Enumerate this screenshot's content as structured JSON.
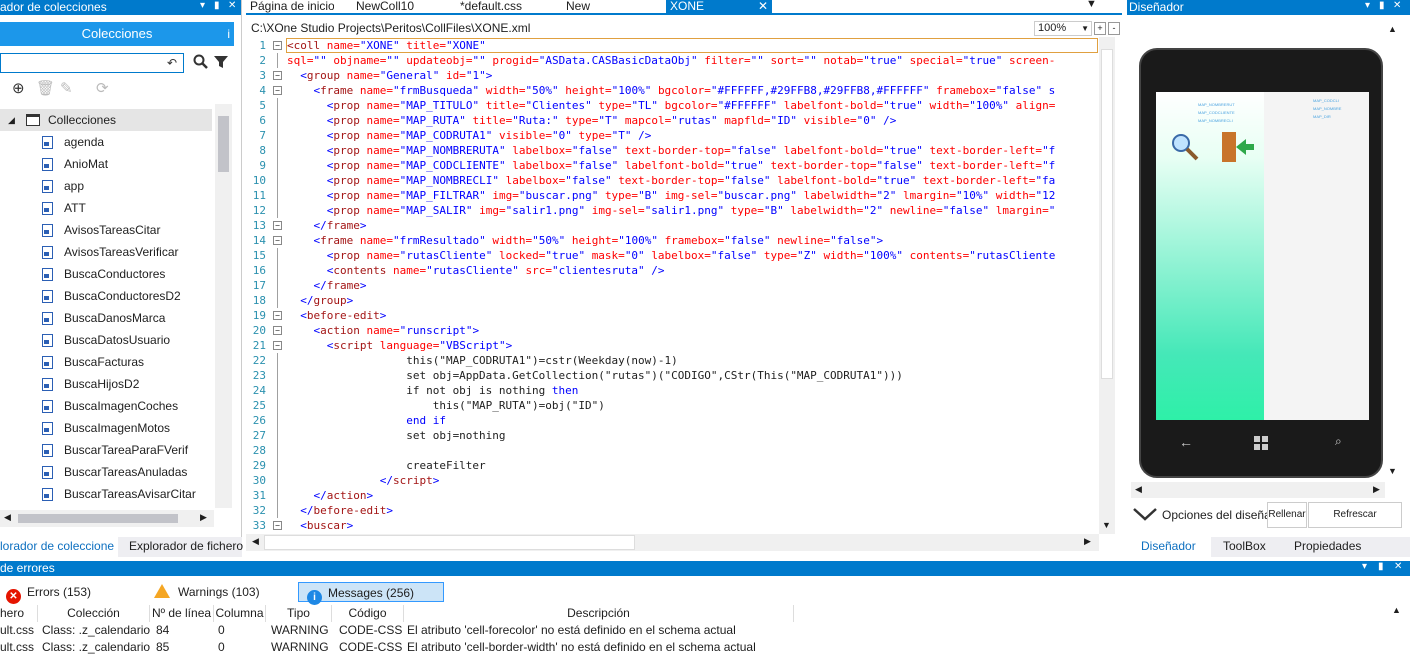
{
  "left_panel": {
    "title": "ador de colecciones",
    "tab_label": "Colecciones",
    "info_glyph": "i",
    "search_placeholder": "",
    "root_label": "Collecciones",
    "items": [
      "agenda",
      "AnioMat",
      "app",
      "ATT",
      "AvisosTareasCitar",
      "AvisosTareasVerificar",
      "BuscaConductores",
      "BuscaConductoresD2",
      "BuscaDanosMarca",
      "BuscaDatosUsuario",
      "BuscaFacturas",
      "BuscaHijosD2",
      "BuscaImagenCoches",
      "BuscaImagenMotos",
      "BuscarTareaParaFVerif",
      "BuscarTareasAnuladas",
      "BuscarTareasAvisarCitar"
    ],
    "bottom_tabs": [
      "lorador de coleccione",
      "Explorador de fichero"
    ]
  },
  "editor": {
    "tabs": [
      "Página de inicio",
      "NewColl10",
      "*default.css",
      "New",
      "XONE"
    ],
    "path": "C:\\XOne Studio Projects\\Peritos\\CollFiles\\XONE.xml",
    "zoom": "100%",
    "zoom_plus": "+",
    "zoom_minus": "-",
    "line_numbers": [
      "1",
      "2",
      "3",
      "4",
      "5",
      "6",
      "7",
      "8",
      "9",
      "10",
      "11",
      "12",
      "13",
      "14",
      "15",
      "16",
      "17",
      "18",
      "19",
      "20",
      "21",
      "22",
      "23",
      "24",
      "25",
      "26",
      "27",
      "28",
      "29",
      "30",
      "31",
      "32",
      "33"
    ]
  },
  "code_lines": [
    [
      [
        "t",
        "<coll "
      ],
      [
        "a",
        "name="
      ],
      [
        "v",
        "\"XONE\" "
      ],
      [
        "a",
        "title="
      ],
      [
        "v",
        "\"XONE\""
      ]
    ],
    [
      [
        "a",
        "sql="
      ],
      [
        "v",
        "\"\" "
      ],
      [
        "a",
        "objname="
      ],
      [
        "v",
        "\"\" "
      ],
      [
        "a",
        "updateobj="
      ],
      [
        "v",
        "\"\" "
      ],
      [
        "a",
        "progid="
      ],
      [
        "v",
        "\"ASData.CASBasicDataObj\" "
      ],
      [
        "a",
        "filter="
      ],
      [
        "v",
        "\"\" "
      ],
      [
        "a",
        "sort="
      ],
      [
        "v",
        "\"\" "
      ],
      [
        "a",
        "notab="
      ],
      [
        "v",
        "\"true\" "
      ],
      [
        "a",
        "special="
      ],
      [
        "v",
        "\"true\" "
      ],
      [
        "a",
        "screen-"
      ]
    ],
    [
      [
        "s",
        "  "
      ],
      [
        "p",
        "<"
      ],
      [
        "t",
        "group "
      ],
      [
        "a",
        "name="
      ],
      [
        "v",
        "\"General\" "
      ],
      [
        "a",
        "id="
      ],
      [
        "v",
        "\"1\""
      ],
      [
        "p",
        ">"
      ]
    ],
    [
      [
        "s",
        "    "
      ],
      [
        "p",
        "<"
      ],
      [
        "t",
        "frame "
      ],
      [
        "a",
        "name="
      ],
      [
        "v",
        "\"frmBusqueda\" "
      ],
      [
        "a",
        "width="
      ],
      [
        "v",
        "\"50%\" "
      ],
      [
        "a",
        "height="
      ],
      [
        "v",
        "\"100%\" "
      ],
      [
        "a",
        "bgcolor="
      ],
      [
        "v",
        "\"#FFFFFF,#29FFB8,#29FFB8,#FFFFFF\" "
      ],
      [
        "a",
        "framebox="
      ],
      [
        "v",
        "\"false\" s"
      ]
    ],
    [
      [
        "s",
        "      "
      ],
      [
        "p",
        "<"
      ],
      [
        "t",
        "prop "
      ],
      [
        "a",
        "name="
      ],
      [
        "v",
        "\"MAP_TITULO\" "
      ],
      [
        "a",
        "title="
      ],
      [
        "v",
        "\"Clientes\" "
      ],
      [
        "a",
        "type="
      ],
      [
        "v",
        "\"TL\" "
      ],
      [
        "a",
        "bgcolor="
      ],
      [
        "v",
        "\"#FFFFFF\" "
      ],
      [
        "a",
        "labelfont-bold="
      ],
      [
        "v",
        "\"true\" "
      ],
      [
        "a",
        "width="
      ],
      [
        "v",
        "\"100%\" "
      ],
      [
        "a",
        "align="
      ]
    ],
    [
      [
        "s",
        "      "
      ],
      [
        "p",
        "<"
      ],
      [
        "t",
        "prop "
      ],
      [
        "a",
        "name="
      ],
      [
        "v",
        "\"MAP_RUTA\" "
      ],
      [
        "a",
        "title="
      ],
      [
        "v",
        "\"Ruta:\" "
      ],
      [
        "a",
        "type="
      ],
      [
        "v",
        "\"T\" "
      ],
      [
        "a",
        "mapcol="
      ],
      [
        "v",
        "\"rutas\" "
      ],
      [
        "a",
        "mapfld="
      ],
      [
        "v",
        "\"ID\" "
      ],
      [
        "a",
        "visible="
      ],
      [
        "v",
        "\"0\" "
      ],
      [
        "p",
        "/>"
      ]
    ],
    [
      [
        "s",
        "      "
      ],
      [
        "p",
        "<"
      ],
      [
        "t",
        "prop "
      ],
      [
        "a",
        "name="
      ],
      [
        "v",
        "\"MAP_CODRUTA1\" "
      ],
      [
        "a",
        "visible="
      ],
      [
        "v",
        "\"0\" "
      ],
      [
        "a",
        "type="
      ],
      [
        "v",
        "\"T\" "
      ],
      [
        "p",
        "/>"
      ]
    ],
    [
      [
        "s",
        "      "
      ],
      [
        "p",
        "<"
      ],
      [
        "t",
        "prop "
      ],
      [
        "a",
        "name="
      ],
      [
        "v",
        "\"MAP_NOMBRERUTA\" "
      ],
      [
        "a",
        "labelbox="
      ],
      [
        "v",
        "\"false\" "
      ],
      [
        "a",
        "text-border-top="
      ],
      [
        "v",
        "\"false\" "
      ],
      [
        "a",
        "labelfont-bold="
      ],
      [
        "v",
        "\"true\" "
      ],
      [
        "a",
        "text-border-left="
      ],
      [
        "v",
        "\"f"
      ]
    ],
    [
      [
        "s",
        "      "
      ],
      [
        "p",
        "<"
      ],
      [
        "t",
        "prop "
      ],
      [
        "a",
        "name="
      ],
      [
        "v",
        "\"MAP_CODCLIENTE\" "
      ],
      [
        "a",
        "labelbox="
      ],
      [
        "v",
        "\"false\" "
      ],
      [
        "a",
        "labelfont-bold="
      ],
      [
        "v",
        "\"true\" "
      ],
      [
        "a",
        "text-border-top="
      ],
      [
        "v",
        "\"false\" "
      ],
      [
        "a",
        "text-border-left="
      ],
      [
        "v",
        "\"f"
      ]
    ],
    [
      [
        "s",
        "      "
      ],
      [
        "p",
        "<"
      ],
      [
        "t",
        "prop "
      ],
      [
        "a",
        "name="
      ],
      [
        "v",
        "\"MAP_NOMBRECLI\" "
      ],
      [
        "a",
        "labelbox="
      ],
      [
        "v",
        "\"false\" "
      ],
      [
        "a",
        "text-border-top="
      ],
      [
        "v",
        "\"false\" "
      ],
      [
        "a",
        "labelfont-bold="
      ],
      [
        "v",
        "\"true\" "
      ],
      [
        "a",
        "text-border-left="
      ],
      [
        "v",
        "\"fa"
      ]
    ],
    [
      [
        "s",
        "      "
      ],
      [
        "p",
        "<"
      ],
      [
        "t",
        "prop "
      ],
      [
        "a",
        "name="
      ],
      [
        "v",
        "\"MAP_FILTRAR\" "
      ],
      [
        "a",
        "img="
      ],
      [
        "v",
        "\"buscar.png\" "
      ],
      [
        "a",
        "type="
      ],
      [
        "v",
        "\"B\" "
      ],
      [
        "a",
        "img-sel="
      ],
      [
        "v",
        "\"buscar.png\" "
      ],
      [
        "a",
        "labelwidth="
      ],
      [
        "v",
        "\"2\" "
      ],
      [
        "a",
        "lmargin="
      ],
      [
        "v",
        "\"10%\" "
      ],
      [
        "a",
        "width="
      ],
      [
        "v",
        "\"12"
      ]
    ],
    [
      [
        "s",
        "      "
      ],
      [
        "p",
        "<"
      ],
      [
        "t",
        "prop "
      ],
      [
        "a",
        "name="
      ],
      [
        "v",
        "\"MAP_SALIR\" "
      ],
      [
        "a",
        "img="
      ],
      [
        "v",
        "\"salir1.png\" "
      ],
      [
        "a",
        "img-sel="
      ],
      [
        "v",
        "\"salir1.png\" "
      ],
      [
        "a",
        "type="
      ],
      [
        "v",
        "\"B\" "
      ],
      [
        "a",
        "labelwidth="
      ],
      [
        "v",
        "\"2\" "
      ],
      [
        "a",
        "newline="
      ],
      [
        "v",
        "\"false\" "
      ],
      [
        "a",
        "lmargin="
      ],
      [
        "v",
        "\""
      ]
    ],
    [
      [
        "s",
        "    "
      ],
      [
        "p",
        "</"
      ],
      [
        "t",
        "frame"
      ],
      [
        "p",
        ">"
      ]
    ],
    [
      [
        "s",
        "    "
      ],
      [
        "p",
        "<"
      ],
      [
        "t",
        "frame "
      ],
      [
        "a",
        "name="
      ],
      [
        "v",
        "\"frmResultado\" "
      ],
      [
        "a",
        "width="
      ],
      [
        "v",
        "\"50%\" "
      ],
      [
        "a",
        "height="
      ],
      [
        "v",
        "\"100%\" "
      ],
      [
        "a",
        "framebox="
      ],
      [
        "v",
        "\"false\" "
      ],
      [
        "a",
        "newline="
      ],
      [
        "v",
        "\"false\""
      ],
      [
        "p",
        ">"
      ]
    ],
    [
      [
        "s",
        "      "
      ],
      [
        "p",
        "<"
      ],
      [
        "t",
        "prop "
      ],
      [
        "a",
        "name="
      ],
      [
        "v",
        "\"rutasCliente\" "
      ],
      [
        "a",
        "locked="
      ],
      [
        "v",
        "\"true\" "
      ],
      [
        "a",
        "mask="
      ],
      [
        "v",
        "\"0\" "
      ],
      [
        "a",
        "labelbox="
      ],
      [
        "v",
        "\"false\" "
      ],
      [
        "a",
        "type="
      ],
      [
        "v",
        "\"Z\" "
      ],
      [
        "a",
        "width="
      ],
      [
        "v",
        "\"100%\" "
      ],
      [
        "a",
        "contents="
      ],
      [
        "v",
        "\"rutasCliente"
      ]
    ],
    [
      [
        "s",
        "      "
      ],
      [
        "p",
        "<"
      ],
      [
        "t",
        "contents "
      ],
      [
        "a",
        "name="
      ],
      [
        "v",
        "\"rutasCliente\" "
      ],
      [
        "a",
        "src="
      ],
      [
        "v",
        "\"clientesruta\" "
      ],
      [
        "p",
        "/>"
      ]
    ],
    [
      [
        "s",
        "    "
      ],
      [
        "p",
        "</"
      ],
      [
        "t",
        "frame"
      ],
      [
        "p",
        ">"
      ]
    ],
    [
      [
        "s",
        "  "
      ],
      [
        "p",
        "</"
      ],
      [
        "t",
        "group"
      ],
      [
        "p",
        ">"
      ]
    ],
    [
      [
        "s",
        "  "
      ],
      [
        "p",
        "<"
      ],
      [
        "t",
        "before-edit"
      ],
      [
        "p",
        ">"
      ]
    ],
    [
      [
        "s",
        "    "
      ],
      [
        "p",
        "<"
      ],
      [
        "t",
        "action "
      ],
      [
        "a",
        "name="
      ],
      [
        "v",
        "\"runscript\""
      ],
      [
        "p",
        ">"
      ]
    ],
    [
      [
        "s",
        "      "
      ],
      [
        "p",
        "<"
      ],
      [
        "t",
        "script "
      ],
      [
        "a",
        "language="
      ],
      [
        "v",
        "\"VBScript\""
      ],
      [
        "p",
        ">"
      ]
    ],
    [
      [
        "s",
        "                  this(\"MAP_CODRUTA1\")=cstr(Weekday(now)-1)"
      ]
    ],
    [
      [
        "s",
        "                  set obj=AppData.GetCollection(\"rutas\")(\"CODIGO\",CStr(This(\"MAP_CODRUTA1\")))"
      ]
    ],
    [
      [
        "s",
        "                  if not obj is nothing "
      ],
      [
        "v",
        "then"
      ]
    ],
    [
      [
        "s",
        "                      this(\"MAP_RUTA\")=obj(\"ID\")"
      ]
    ],
    [
      [
        "s",
        "                  "
      ],
      [
        "v",
        "end if"
      ]
    ],
    [
      [
        "s",
        "                  set obj=nothing"
      ]
    ],
    [
      [
        "s",
        ""
      ]
    ],
    [
      [
        "s",
        "                  createFilter"
      ]
    ],
    [
      [
        "s",
        "              "
      ],
      [
        "p",
        "</"
      ],
      [
        "t",
        "script"
      ],
      [
        "p",
        ">"
      ]
    ],
    [
      [
        "s",
        "    "
      ],
      [
        "p",
        "</"
      ],
      [
        "t",
        "action"
      ],
      [
        "p",
        ">"
      ]
    ],
    [
      [
        "s",
        "  "
      ],
      [
        "p",
        "</"
      ],
      [
        "t",
        "before-edit"
      ],
      [
        "p",
        ">"
      ]
    ],
    [
      [
        "s",
        "  "
      ],
      [
        "p",
        "<"
      ],
      [
        "t",
        "buscar"
      ],
      [
        "p",
        ">"
      ]
    ]
  ],
  "designer": {
    "title": "Diseñador",
    "screen_labels_left": [
      "MAP_NOMBRERUT",
      "MAP_CODCLIENTE",
      "MAP_NOMBRECLI"
    ],
    "screen_labels_right": [
      "MAP_CODCLI",
      "MAP_NOMBRE",
      "MAP_DIR"
    ],
    "options_label": "Opciones del diseña",
    "rellenar_label": "Rellenar",
    "refrescar_label": "Refrescar",
    "tabs": [
      "Diseñador",
      "ToolBox",
      "Propiedades"
    ]
  },
  "errors_panel": {
    "title": "de errores",
    "errors_tab": "Errors (153)",
    "warnings_tab": "Warnings (103)",
    "messages_tab": "Messages (256)",
    "columns": [
      "hero",
      "Colección",
      "Nº de línea",
      "Columna",
      "Tipo",
      "Código",
      "Descripción"
    ],
    "rows": [
      [
        "ult.css",
        "Class: .z_calendario",
        "84",
        "0",
        "WARNING",
        "CODE-CSS",
        "El atributo 'cell-forecolor' no está definido en el schema actual"
      ],
      [
        "ult.css",
        "Class: .z_calendario",
        "85",
        "0",
        "WARNING",
        "CODE-CSS",
        "El atributo 'cell-border-width' no está definido en el schema actual"
      ]
    ]
  },
  "colors": {
    "accent": "#007acc",
    "tab_blue": "#1c97ea",
    "tag": "#a31515",
    "attr": "#ff0000",
    "value": "#0000ff"
  }
}
